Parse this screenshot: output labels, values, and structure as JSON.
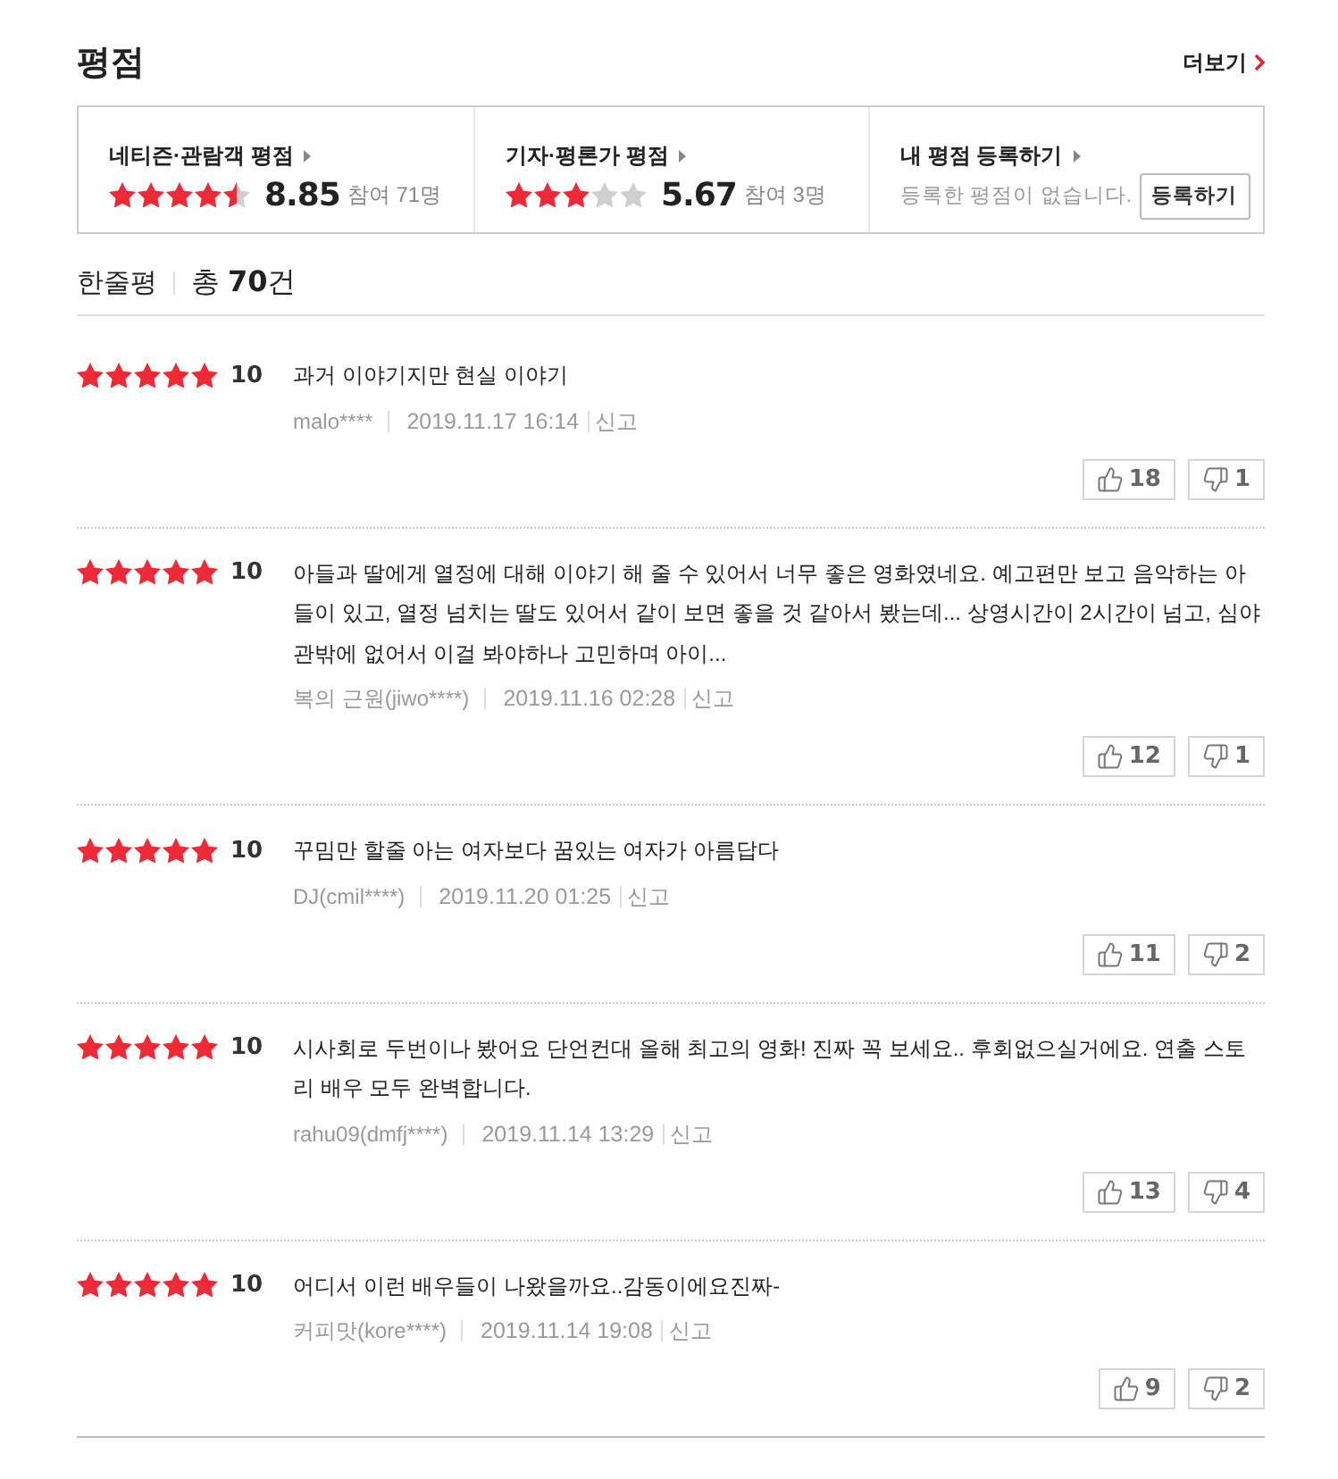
{
  "header": {
    "title": "평점",
    "more_link": "더보기"
  },
  "rating_summary": [
    {
      "kind": "score",
      "label": "네티즌·관람객 평점",
      "stars": 4.5,
      "score": "8.85",
      "participants": "참여 71명"
    },
    {
      "kind": "score",
      "label": "기자·평론가 평점",
      "stars": 3,
      "score": "5.67",
      "participants": "참여 3명"
    },
    {
      "kind": "register",
      "label": "내 평점 등록하기",
      "message": "등록한 평점이 없습니다.",
      "button": "등록하기"
    }
  ],
  "comments": {
    "title": "한줄평",
    "total": "총 **70**건"
  },
  "reviews": [
    {
      "stars": 5,
      "score": "10",
      "text": "과거 이야기지만 현실 이야기",
      "author": "malo****",
      "date": "2019.11.17 16:14",
      "report": "신고",
      "likes": "18",
      "dislikes": "1"
    },
    {
      "stars": 5,
      "score": "10",
      "text": "아들과 딸에게 열정에 대해 이야기 해 줄 수 있어서 너무 좋은 영화였네요. 예고편만 보고 음악하는 아들이 있고, 열정 넘치는 딸도 있어서 같이 보면 좋을 것 같아서 봤는데... 상영시간이 2시간이 넘고, 심야관밖에 없어서 이걸 봐야하나 고민하며 아이...",
      "author": "복의 근원(jiwo****)",
      "date": "2019.11.16 02:28",
      "report": "신고",
      "likes": "12",
      "dislikes": "1"
    },
    {
      "stars": 5,
      "score": "10",
      "text": "꾸밈만 할줄 아는 여자보다 꿈있는 여자가 아름답다",
      "author": "DJ(cmil****)",
      "date": "2019.11.20 01:25",
      "report": "신고",
      "likes": "11",
      "dislikes": "2"
    },
    {
      "stars": 5,
      "score": "10",
      "text": "시사회로 두번이나 봤어요 단언컨대 올해 최고의 영화! 진짜 꼭 보세요.. 후회없으실거에요. 연출 스토리 배우 모두 완벽합니다.",
      "author": "rahu09(dmfj****)",
      "date": "2019.11.14 13:29",
      "report": "신고",
      "likes": "13",
      "dislikes": "4"
    },
    {
      "stars": 5,
      "score": "10",
      "text": "어디서 이런 배우들이 나왔을까요..감동이에요진짜-",
      "author": "커피맛(kore****)",
      "date": "2019.11.14 19:08",
      "report": "신고",
      "likes": "9",
      "dislikes": "2"
    }
  ]
}
